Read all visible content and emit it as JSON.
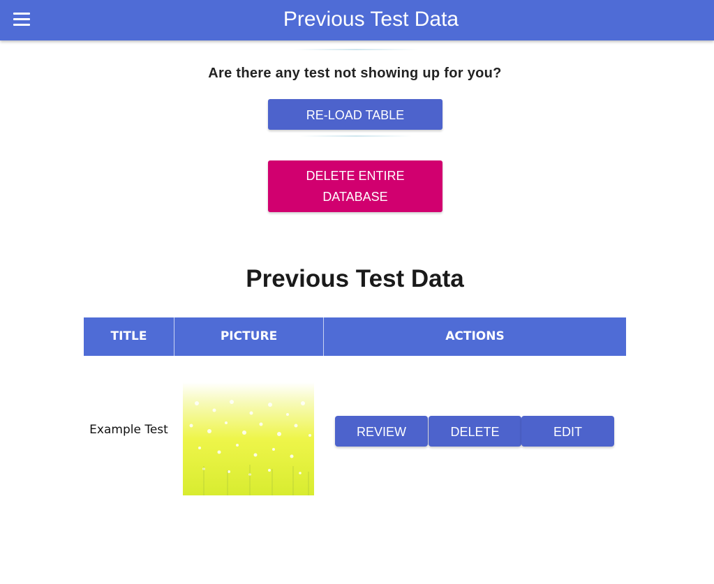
{
  "header": {
    "title": "Previous Test Data",
    "menu_icon": "hamburger-menu-icon"
  },
  "prompt": {
    "question": "Are there any test not showing up for you?"
  },
  "buttons": {
    "reload_label": "RE-LOAD TABLE",
    "delete_database_label": "DELETE ENTIRE DATABASE"
  },
  "section": {
    "title": "Previous Test Data"
  },
  "table": {
    "columns": [
      "TITLE",
      "PICTURE",
      "ACTIONS"
    ],
    "rows": [
      {
        "title": "Example Test",
        "actions": [
          "REVIEW",
          "DELETE",
          "EDIT"
        ]
      }
    ]
  },
  "colors": {
    "primary": "#4f6cd6",
    "button_blue": "#4d63cc",
    "danger": "#d1006f"
  }
}
